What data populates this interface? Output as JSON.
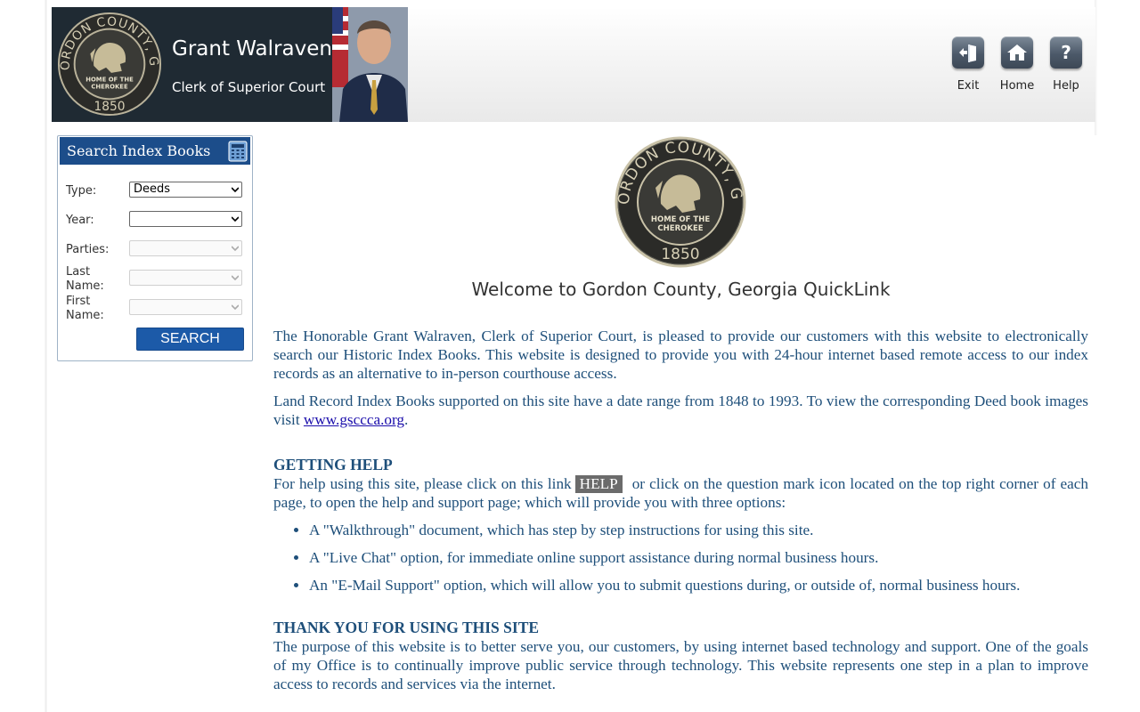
{
  "header": {
    "clerk_name": "Grant Walraven",
    "clerk_title": "Clerk of Superior Court",
    "seal_text_top": "GORDON COUNTY, GA.",
    "seal_text_mid": "HOME OF THE CHEROKEE",
    "seal_year": "1850",
    "buttons": [
      {
        "label": "Exit",
        "icon": "exit-icon"
      },
      {
        "label": "Home",
        "icon": "home-icon"
      },
      {
        "label": "Help",
        "icon": "help-icon"
      }
    ]
  },
  "search_panel": {
    "title": "Search Index Books",
    "icon": "calculator-icon",
    "fields": {
      "type_label": "Type:",
      "type_value": "Deeds",
      "year_label": "Year:",
      "year_value": "",
      "parties_label": "Parties:",
      "last_name_label": "Last Name:",
      "first_name_label": "First Name:"
    },
    "search_button": "SEARCH"
  },
  "main": {
    "welcome": "Welcome to Gordon County, Georgia QuickLink",
    "intro": "The Honorable Grant Walraven, Clerk of Superior Court, is pleased to provide our customers with this website to electronically search our Historic Index Books. This website is designed to provide you with 24-hour internet based remote access to our index records as an alternative to in-person courthouse access.",
    "range_text_before": "Land Record Index Books supported on this site have a date range from 1848 to 1993. To view the corresponding Deed book images visit ",
    "range_link": "www.gsccca.org",
    "range_text_after": ".",
    "help_heading": "GETTING HELP",
    "help_text_before": "For help using this site, please click on this link",
    "help_badge": "HELP",
    "help_text_after": " or click on the question mark icon located on the top right corner of each page, to open the help and support page; which will provide you with three options:",
    "options": [
      "A \"Walkthrough\" document, which has step by step instructions for using this site.",
      "A \"Live Chat\" option, for immediate online support assistance during normal business hours.",
      "An \"E-Mail Support\" option, which will allow you to submit questions during, or outside of, normal business hours."
    ],
    "thanks_heading": "THANK YOU FOR USING THIS SITE",
    "thanks_text": "The purpose of this website is to better serve you, our customers, by using internet based technology and support. One of the goals of my Office is to continually improve public service through technology. This website represents one step in a plan to improve access to records and services via the internet."
  },
  "colors": {
    "header_dark": "#1f2a33",
    "panel_blue": "#1c4d8a",
    "button_blue": "#1c5aa8",
    "text_blue": "#1e4f7a"
  }
}
